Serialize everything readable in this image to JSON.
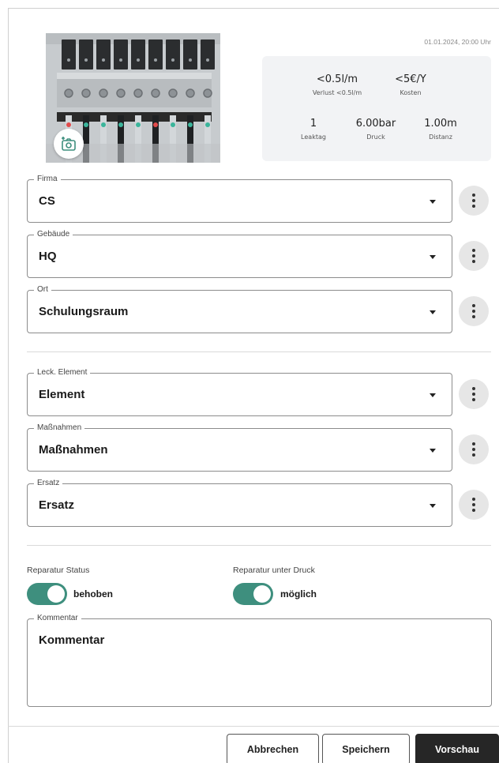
{
  "header": {
    "timestamp": "01.01.2024, 20:00 Uhr"
  },
  "photo": {
    "camera_icon": "add-photo-icon"
  },
  "stats": {
    "loss_value": "<0.5l/m",
    "loss_label": "Verlust <0.5l/m",
    "cost_value": "<5€/Y",
    "cost_label": "Kosten",
    "leaktag_value": "1",
    "leaktag_label": "Leaktag",
    "pressure_value": "6.00bar",
    "pressure_label": "Druck",
    "distance_value": "1.00m",
    "distance_label": "Distanz"
  },
  "location": {
    "firma": {
      "label": "Firma",
      "value": "CS"
    },
    "gebaeude": {
      "label": "Gebäude",
      "value": "HQ"
    },
    "ort": {
      "label": "Ort",
      "value": "Schulungsraum"
    }
  },
  "details": {
    "element": {
      "label": "Leck. Element",
      "value": "Element"
    },
    "massnahmen": {
      "label": "Maßnahmen",
      "value": "Maßnahmen"
    },
    "ersatz": {
      "label": "Ersatz",
      "value": "Ersatz"
    }
  },
  "switches": {
    "repair_status": {
      "label": "Reparatur Status",
      "text": "behoben",
      "on": true
    },
    "repair_pressure": {
      "label": "Reparatur unter Druck",
      "text": "möglich",
      "on": true
    }
  },
  "comment": {
    "label": "Kommentar",
    "value": "Kommentar"
  },
  "footer": {
    "cancel": "Abbrechen",
    "save": "Speichern",
    "preview": "Vorschau"
  },
  "colors": {
    "toggle_on": "#3e8f7e",
    "primary_button": "#262626",
    "stats_bg": "#f2f3f5"
  }
}
